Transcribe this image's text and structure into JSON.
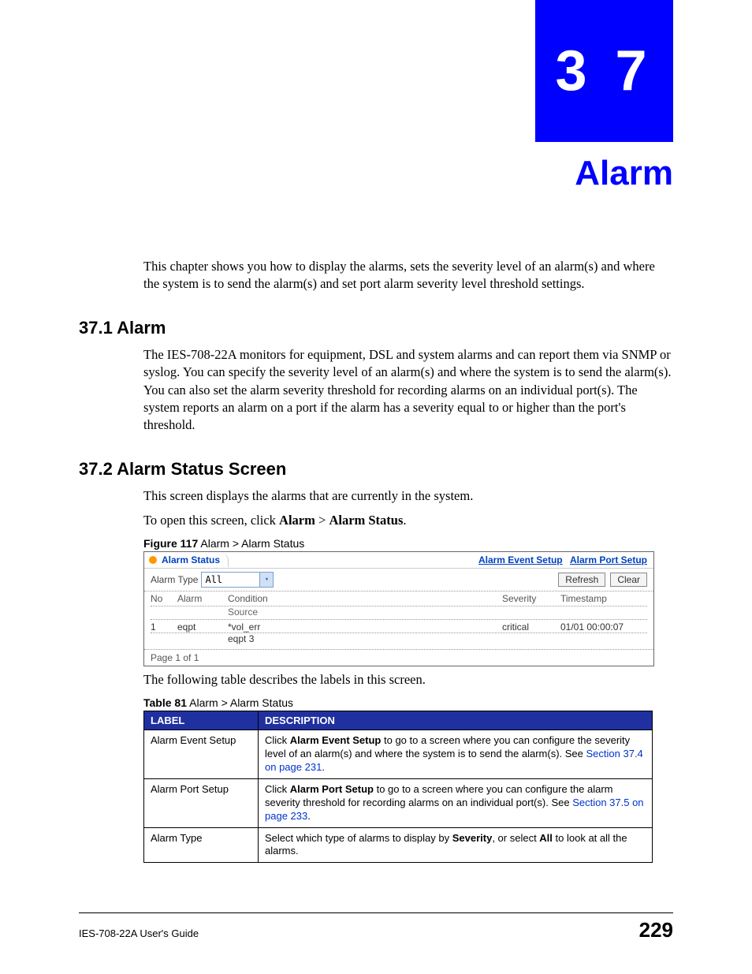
{
  "chapter_number": "3 7",
  "chapter_title": "Alarm",
  "intro_text": "This chapter shows you how to display the alarms, sets the severity level of an alarm(s) and where the system is to send the alarm(s) and set port alarm severity level threshold settings.",
  "section1": {
    "heading": "37.1  Alarm",
    "body": "The IES-708-22A monitors for equipment, DSL and system alarms and can report them via SNMP or syslog. You can specify the severity level of an alarm(s) and where the system is to send the alarm(s). You can also set the alarm severity threshold for recording alarms on an individual port(s). The system reports an alarm on a port if the alarm has a severity equal to or higher than the port's threshold."
  },
  "section2": {
    "heading": "37.2  Alarm Status Screen",
    "body1": "This screen displays the alarms that are currently in the system.",
    "body2_pre": "To open this screen, click ",
    "body2_b1": "Alarm",
    "body2_mid": " > ",
    "body2_b2": "Alarm Status",
    "body2_post": "."
  },
  "figure": {
    "caption_label": "Figure 117",
    "caption_text": "   Alarm > Alarm Status",
    "tab_title": "Alarm Status",
    "link1": "Alarm Event Setup",
    "link2": "Alarm Port Setup",
    "type_label": "Alarm Type",
    "type_value": "All",
    "btn_refresh": "Refresh",
    "btn_clear": "Clear",
    "headers": {
      "no": "No",
      "alarm": "Alarm",
      "condition": "Condition",
      "source": "Source",
      "severity": "Severity",
      "timestamp": "Timestamp"
    },
    "row": {
      "no": "1",
      "alarm": "eqpt",
      "condition": "*vol_err",
      "source": "eqpt 3",
      "severity": "critical",
      "timestamp": "01/01 00:00:07"
    },
    "footer": "Page  1 of  1"
  },
  "post_figure_text": "The following table describes the labels in this screen.",
  "table": {
    "caption_label": "Table 81",
    "caption_text": "   Alarm > Alarm Status",
    "header_label": "LABEL",
    "header_desc": "DESCRIPTION",
    "rows": [
      {
        "label": "Alarm Event Setup",
        "pre": "Click ",
        "bold": "Alarm Event Setup",
        "mid": " to go to a screen where you can configure the severity level of an alarm(s) and where the system is to send the alarm(s). See ",
        "link": "Section 37.4 on page 231",
        "post": "."
      },
      {
        "label": "Alarm Port Setup",
        "pre": "Click ",
        "bold": "Alarm Port Setup",
        "mid": " to go to a screen where you can configure the alarm severity threshold for recording alarms on an individual port(s). See ",
        "link": "Section 37.5 on page 233",
        "post": "."
      },
      {
        "label": "Alarm Type",
        "pre": "Select which type of alarms to display by ",
        "bold": "Severity",
        "mid": ", or select ",
        "bold2": "All",
        "post": " to look at all the alarms."
      }
    ]
  },
  "footer": {
    "left": "IES-708-22A User's Guide",
    "right": "229"
  }
}
